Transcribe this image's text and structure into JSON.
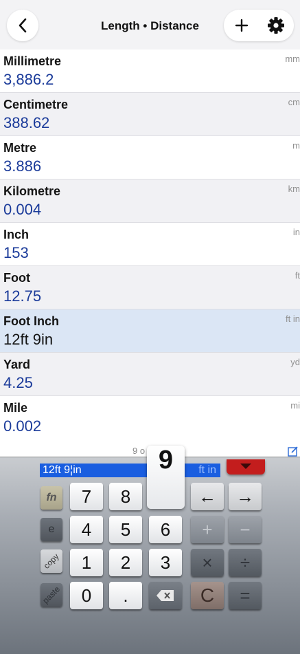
{
  "header": {
    "title": "Length • Distance",
    "back_icon": "chevron-left-icon",
    "add_icon": "plus-icon",
    "settings_icon": "gear-icon"
  },
  "units": [
    {
      "name": "Millimetre",
      "value": "3,886.2",
      "unit": "mm"
    },
    {
      "name": "Centimetre",
      "value": "388.62",
      "unit": "cm"
    },
    {
      "name": "Metre",
      "value": "3.886",
      "unit": "m"
    },
    {
      "name": "Kilometre",
      "value": "0.004",
      "unit": "km"
    },
    {
      "name": "Inch",
      "value": "153",
      "unit": "in"
    },
    {
      "name": "Foot",
      "value": "12.75",
      "unit": "ft"
    },
    {
      "name": "Foot Inch",
      "value": "12ft 9in",
      "unit": "ft in"
    },
    {
      "name": "Yard",
      "value": "4.25",
      "unit": "yd"
    },
    {
      "name": "Mile",
      "value": "0.002",
      "unit": "mi"
    }
  ],
  "partial_row_text": "9 o",
  "keypad": {
    "display_value": "12ft 9¦in",
    "display_unit": "ft in",
    "popup_key": "9",
    "keys": {
      "fn": "fn",
      "e": "e",
      "copy": "copy",
      "paste": "paste",
      "k7": "7",
      "k8": "8",
      "k4": "4",
      "k5": "5",
      "k6": "6",
      "k1": "1",
      "k2": "2",
      "k3": "3",
      "k0": "0",
      "dot": ".",
      "left": "←",
      "right": "→",
      "plus": "+",
      "minus": "−",
      "times": "×",
      "divide": "÷",
      "clear": "C",
      "equals": "="
    }
  },
  "colors": {
    "value_blue": "#1b3b9a",
    "selected_row": "#dbe6f5",
    "display_blue": "#1a5ee0",
    "dismiss_red": "#c31d1d"
  }
}
